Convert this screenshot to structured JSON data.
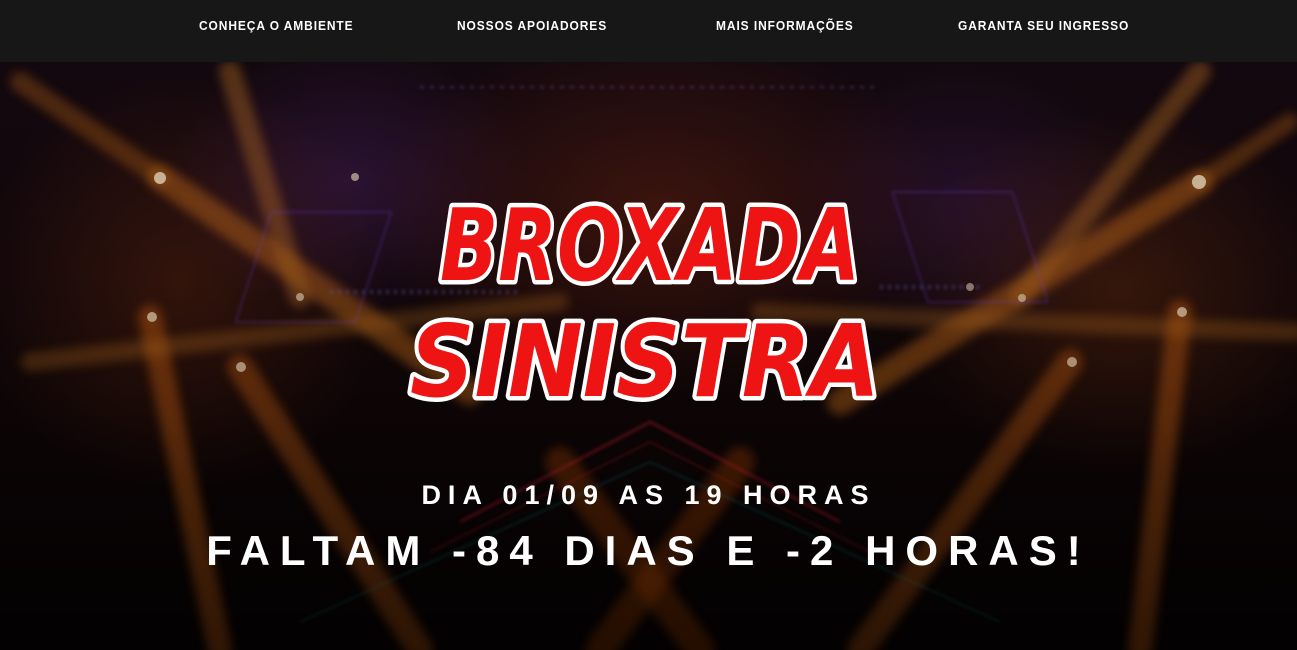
{
  "nav": {
    "items": [
      {
        "label": "CONHEÇA O AMBIENTE"
      },
      {
        "label": "NOSSOS APOIADORES"
      },
      {
        "label": "MAIS INFORMAÇÕES"
      },
      {
        "label": "GARANTA SEU INGRESSO"
      }
    ]
  },
  "hero": {
    "title_line1": "BROXADA",
    "title_line2": "SINISTRA",
    "date_text": "DIA 01/09 AS 19 HORAS",
    "countdown_text": "FALTAM -84 DIAS E -2 HORAS!"
  },
  "colors": {
    "nav_background": "#171717",
    "title_fill": "#ef1414",
    "title_outline": "#ffffff",
    "text": "#ffffff"
  }
}
